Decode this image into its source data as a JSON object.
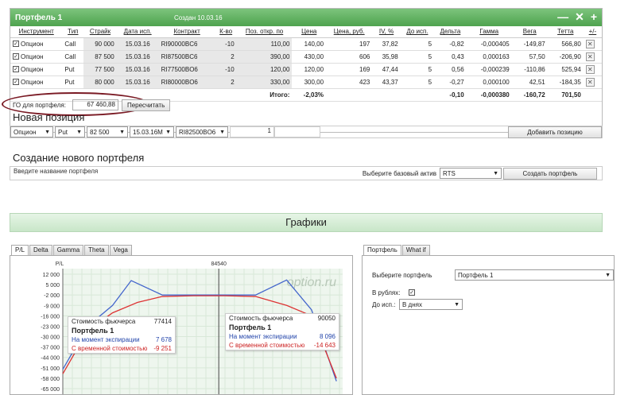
{
  "portfolio": {
    "title": "Портфель 1",
    "created": "Создан 10.03.16",
    "icons": [
      "minus-icon",
      "close-icon",
      "plus-icon"
    ],
    "columns": [
      "Инструмент",
      "Тип",
      "Страйк",
      "Дата исп.",
      "Контракт",
      "К-во",
      "Поз. откр. по",
      "Цена",
      "Цена, руб.",
      "IV, %",
      "До исп.",
      "Дельта",
      "Гамма",
      "Вега",
      "Тетта",
      "+/-"
    ],
    "rows": [
      {
        "instrument": "Опцион",
        "type": "Call",
        "strike": "90 000",
        "date": "15.03.16",
        "contract": "RI90000BC6",
        "qty": "-10",
        "open": "110,00",
        "price": "140,00",
        "price_rub": "197",
        "iv": "37,82",
        "days": "5",
        "delta": "-0,82",
        "gamma": "-0,000405",
        "vega": "-149,87",
        "theta": "566,80"
      },
      {
        "instrument": "Опцион",
        "type": "Call",
        "strike": "87 500",
        "date": "15.03.16",
        "contract": "RI87500BC6",
        "qty": "2",
        "open": "390,00",
        "price": "430,00",
        "price_rub": "606",
        "iv": "35,98",
        "days": "5",
        "delta": "0,43",
        "gamma": "0,000163",
        "vega": "57,50",
        "theta": "-206,90"
      },
      {
        "instrument": "Опцион",
        "type": "Put",
        "strike": "77 500",
        "date": "15.03.16",
        "contract": "RI77500BO6",
        "qty": "-10",
        "open": "120,00",
        "price": "120,00",
        "price_rub": "169",
        "iv": "47,44",
        "days": "5",
        "delta": "0,56",
        "gamma": "-0,000239",
        "vega": "-110,86",
        "theta": "525,94"
      },
      {
        "instrument": "Опцион",
        "type": "Put",
        "strike": "80 000",
        "date": "15.03.16",
        "contract": "RI80000BO6",
        "qty": "2",
        "open": "330,00",
        "price": "300,00",
        "price_rub": "423",
        "iv": "43,37",
        "days": "5",
        "delta": "-0,27",
        "gamma": "0,000100",
        "vega": "42,51",
        "theta": "-184,35"
      }
    ],
    "total": {
      "label": "Итого:",
      "pct": "-2,03%",
      "delta": "-0,10",
      "gamma": "-0,000380",
      "vega": "-160,72",
      "theta": "701,50"
    },
    "go_label": "ГО для портфеля:",
    "go_value": "67 460,88",
    "recalc_button": "Пересчитать"
  },
  "new_position": {
    "title": "Новая позиция",
    "instrument": "Опцион",
    "type": "Put",
    "strike": "82 500",
    "date": "15.03.16M",
    "contract": "RI82500BO6",
    "qty": "1",
    "add_button": "Добавить позицию"
  },
  "new_portfolio": {
    "title": "Создание нового портфеля",
    "name_placeholder": "Введите название портфеля",
    "asset_label": "Выберите базовый актив",
    "asset_value": "RTS",
    "create_button": "Создать портфель"
  },
  "graphs": {
    "title": "Графики",
    "tabs": [
      "P/L",
      "Delta",
      "Gamma",
      "Theta",
      "Vega"
    ],
    "watermark": "option.ru",
    "y_axis_label": "P/L",
    "marker_label": "84540",
    "tip_left": {
      "futures_label": "Стоимость фьючерса",
      "futures_value": "77414",
      "portfolio": "Портфель 1",
      "expiry_label": "На момент экспирации",
      "expiry_value": "7 678",
      "time_label": "С временной стоимостью",
      "time_value": "-9 251"
    },
    "tip_right": {
      "futures_label": "Стоимость фьючерса",
      "futures_value": "90050",
      "portfolio": "Портфель 1",
      "expiry_label": "На момент экспирации",
      "expiry_value": "8 096",
      "time_label": "С временной стоимостью",
      "time_value": "-14 643"
    }
  },
  "settings": {
    "tabs": [
      "Портфель",
      "What if"
    ],
    "portfolio_label": "Выберите портфель",
    "portfolio_value": "Портфель 1",
    "rub_label": "В рублях:",
    "rub_checked": true,
    "until_label": "До исп.:",
    "until_value": "В днях"
  },
  "chart_data": {
    "type": "line",
    "ylabel": "P/L",
    "y_ticks": [
      "12 000",
      "5 000",
      "-2 000",
      "-9 000",
      "-16 000",
      "-23 000",
      "-30 000",
      "-37 000",
      "-44 000",
      "-51 000",
      "-58 000",
      "-65 000"
    ],
    "ylim": [
      -65000,
      12000
    ],
    "series": [
      {
        "color": "#4466cc",
        "x": [
          72000,
          74000,
          76000,
          77500,
          80000,
          82500,
          87500,
          90000,
          92000,
          94000
        ],
        "values": [
          -52000,
          -23000,
          -9000,
          7700,
          -2000,
          -2000,
          -2000,
          8100,
          -12000,
          -60000
        ]
      },
      {
        "color": "#dd3333",
        "x": [
          72000,
          74000,
          76000,
          78000,
          80000,
          82500,
          85000,
          87500,
          90000,
          92000,
          94000
        ],
        "values": [
          -55000,
          -26000,
          -14000,
          -7000,
          -3000,
          -2500,
          -2500,
          -3000,
          -9000,
          -16000,
          -58000
        ]
      }
    ],
    "marker_x": 84540,
    "xlim": [
      72000,
      94500
    ]
  }
}
